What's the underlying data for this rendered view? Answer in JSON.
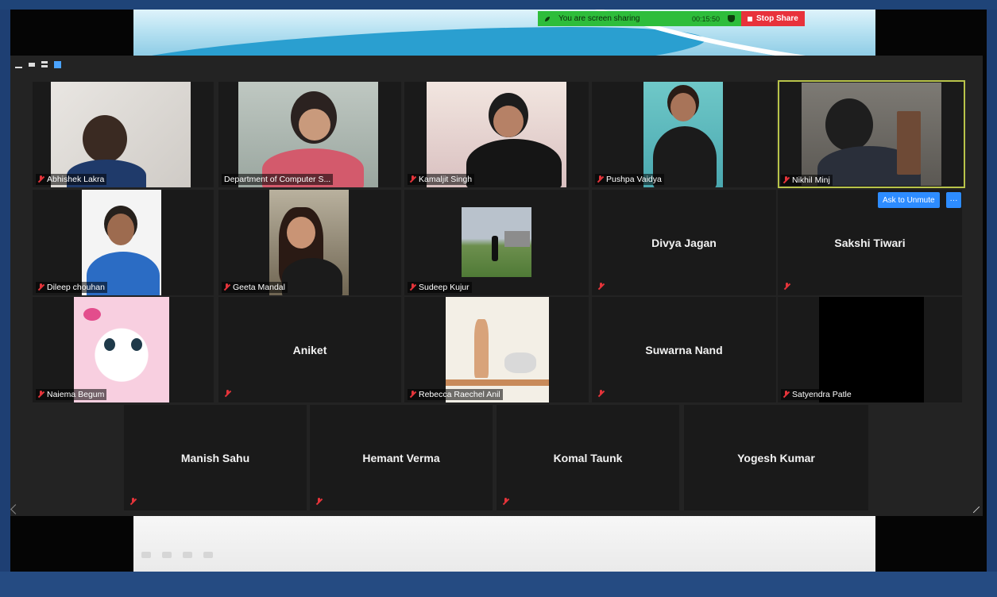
{
  "share_toolbar": {
    "status_text": "You are screen sharing",
    "timer": "00:15:50",
    "stop_label": "Stop Share",
    "status_color": "#2ebd3b",
    "stop_color": "#e8323b"
  },
  "gallery": {
    "view_icons": [
      "minimize-icon",
      "speaker-view-icon",
      "side-by-side-icon",
      "gallery-view-icon"
    ],
    "participants": [
      {
        "name": "Abhishek Lakra",
        "video": true,
        "muted": true
      },
      {
        "name": "Department of Computer S...",
        "video": true,
        "muted": false
      },
      {
        "name": "Kamaljit Singh",
        "video": true,
        "muted": true
      },
      {
        "name": "Pushpa Vaidya",
        "video": true,
        "muted": true
      },
      {
        "name": "Nikhil Minj",
        "video": true,
        "muted": true,
        "active_speaker": true
      },
      {
        "name": "Dileep chouhan",
        "video": true,
        "muted": true
      },
      {
        "name": "Geeta Mandal",
        "video": true,
        "muted": true
      },
      {
        "name": "Sudeep Kujur",
        "video": true,
        "muted": true
      },
      {
        "name": "Divya Jagan",
        "video": false,
        "muted": true
      },
      {
        "name": "Sakshi Tiwari",
        "video": false,
        "muted": true
      },
      {
        "name": "Naiema Begum",
        "video": true,
        "muted": true
      },
      {
        "name": "Aniket",
        "video": false,
        "muted": true
      },
      {
        "name": "Rebecca Raechel Anil",
        "video": true,
        "muted": true
      },
      {
        "name": "Suwarna Nand",
        "video": false,
        "muted": true
      },
      {
        "name": "Satyendra Patle",
        "video": true,
        "muted": true
      },
      {
        "name": "Manish Sahu",
        "video": false,
        "muted": true
      },
      {
        "name": "Hemant Verma",
        "video": false,
        "muted": true
      },
      {
        "name": "Komal Taunk",
        "video": false,
        "muted": true
      },
      {
        "name": "Yogesh Kumar",
        "video": false,
        "muted": false
      }
    ],
    "ask_to_unmute_label": "Ask to Unmute",
    "more_label": "···",
    "active_speaker_color": "#b8c34a",
    "button_color": "#2d8cff",
    "muted_icon_color": "#e5343a"
  }
}
